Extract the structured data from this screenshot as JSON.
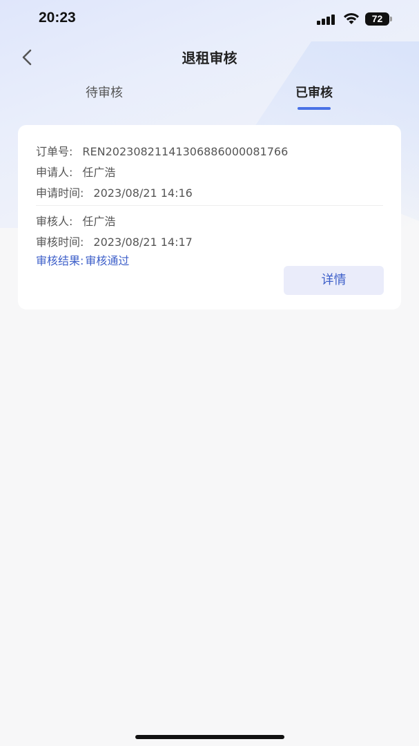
{
  "status_bar": {
    "time": "20:23",
    "battery": "72"
  },
  "nav": {
    "title": "退租审核"
  },
  "tabs": [
    {
      "label": "待审核",
      "active": false
    },
    {
      "label": "已审核",
      "active": true
    }
  ],
  "card": {
    "order_no_label": "订单号:",
    "order_no": "REN20230821141306886000081766",
    "applicant_label": "申请人:",
    "applicant": "任广浩",
    "apply_time_label": "申请时间:",
    "apply_time": "2023/08/21 14:16",
    "reviewer_label": "审核人:",
    "reviewer": "任广浩",
    "review_time_label": "审核时间:",
    "review_time": "2023/08/21 14:17",
    "result_label": "审核结果:",
    "result": "审核通过",
    "detail_button": "详情"
  },
  "colors": {
    "accent": "#4a72e6",
    "link": "#3d5fc9",
    "button_bg": "#eaecfa"
  }
}
